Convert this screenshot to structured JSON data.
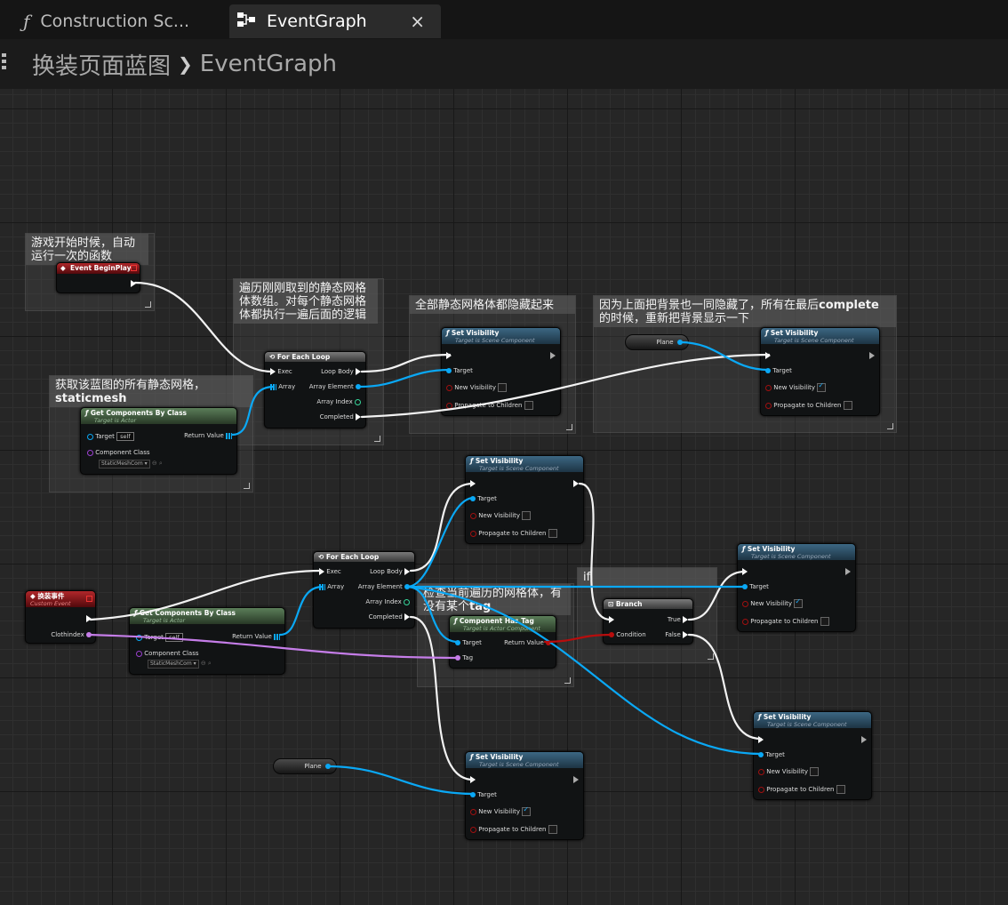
{
  "tabs": [
    {
      "label": "Construction Sc...",
      "icon": "function-icon",
      "active": false
    },
    {
      "label": "EventGraph",
      "icon": "graph-icon",
      "active": true,
      "close": "×"
    }
  ],
  "breadcrumb": {
    "root": "换装页面蓝图",
    "separator": "❯",
    "current": "EventGraph"
  },
  "comments": {
    "c1": "游戏开始时候，自动运行一次的函数",
    "c2": "遍历刚刚取到的静态网格体数组。对每个静态网格体都执行一遍后面的逻辑",
    "c3": "获取该蓝图的所有静态网格，",
    "c3b": "staticmesh",
    "c4": "全部静态网格体都隐藏起来",
    "c5a": "因为上面把背景也一同隐藏了，所有在最后",
    "c5b": "complete",
    "c5c": "的时候，重新把背景显示一下",
    "c6a": "检查当前遍历的网格体，有没有某个",
    "c6b": "tag",
    "c7": "if"
  },
  "nodes": {
    "beginplay": {
      "title": "Event BeginPlay"
    },
    "customevent": {
      "title": "换装事件",
      "subtitle": "Custom Event",
      "param": "Clothindex"
    },
    "getcomp1": {
      "title": "Get Components By Class",
      "subtitle": "Target is Actor",
      "target": "Target",
      "target_value": "self",
      "return": "Return Value",
      "class_label": "Component Class",
      "class_value": "StaticMeshCom"
    },
    "getcomp2": {
      "title": "Get Components By Class",
      "subtitle": "Target is Actor",
      "target": "Target",
      "target_value": "self",
      "return": "Return Value",
      "class_label": "Component Class",
      "class_value": "StaticMeshCom"
    },
    "foreach1": {
      "title": "For Each Loop",
      "exec": "Exec",
      "array": "Array",
      "loop_body": "Loop Body",
      "element": "Array Element",
      "index": "Array Index",
      "completed": "Completed"
    },
    "foreach2": {
      "title": "For Each Loop",
      "exec": "Exec",
      "array": "Array",
      "loop_body": "Loop Body",
      "element": "Array Element",
      "index": "Array Index",
      "completed": "Completed"
    },
    "hastag": {
      "title": "Component Has Tag",
      "subtitle": "Target is Actor Component",
      "target": "Target",
      "tag": "Tag",
      "return": "Return Value"
    },
    "branch": {
      "title": "Branch",
      "condition": "Condition",
      "true": "True",
      "false": "False"
    },
    "plane1": {
      "label": "Plane"
    },
    "plane2": {
      "label": "Plane"
    }
  },
  "setvis": [
    {
      "title": "Set Visibility",
      "subtitle": "Target is Scene Component",
      "target": "Target",
      "newvis": "New Visibility",
      "propagate": "Propagate to Children",
      "checked": false
    },
    {
      "title": "Set Visibility",
      "subtitle": "Target is Scene Component",
      "target": "Target",
      "newvis": "New Visibility",
      "propagate": "Propagate to Children",
      "checked": true
    },
    {
      "title": "Set Visibility",
      "subtitle": "Target is Scene Component",
      "target": "Target",
      "newvis": "New Visibility",
      "propagate": "Propagate to Children",
      "checked": false
    },
    {
      "title": "Set Visibility",
      "subtitle": "Target is Scene Component",
      "target": "Target",
      "newvis": "New Visibility",
      "propagate": "Propagate to Children",
      "checked": true
    },
    {
      "title": "Set Visibility",
      "subtitle": "Target is Scene Component",
      "target": "Target",
      "newvis": "New Visibility",
      "propagate": "Propagate to Children",
      "checked": false
    },
    {
      "title": "Set Visibility",
      "subtitle": "Target is Scene Component",
      "target": "Target",
      "newvis": "New Visibility",
      "propagate": "Propagate to Children",
      "checked": true
    }
  ],
  "colors": {
    "exec": "#ffffff",
    "object": "#0aa8f5",
    "bool": "#b80d0d",
    "name": "#c57de8",
    "int": "#37d59a"
  }
}
